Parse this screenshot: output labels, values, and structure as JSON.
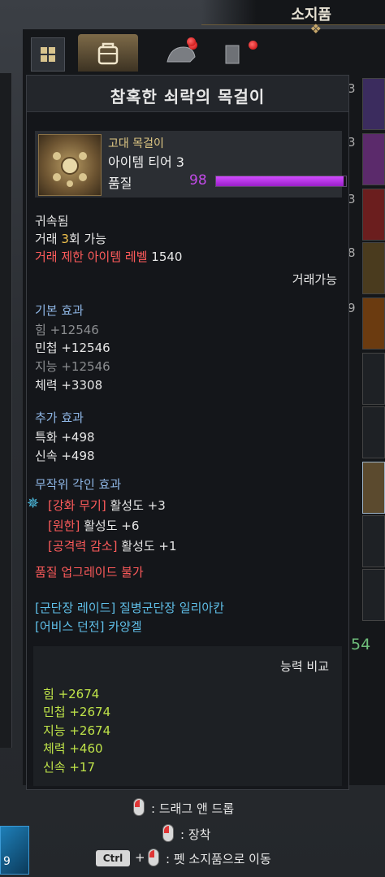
{
  "inventory": {
    "title": "소지품",
    "tabs": [
      "grid-tab",
      "bag-tab",
      "helmet-tab",
      "book-tab"
    ],
    "side_slot_numbers": [
      "3",
      "3",
      "3",
      "8",
      "9"
    ],
    "money": "54"
  },
  "tooltip": {
    "title": "참혹한 쇠락의 목걸이",
    "item": {
      "grade": "고대 목걸이",
      "tier": "아이템 티어 3",
      "quality_label": "품질",
      "quality_value": "98",
      "quality_fraction": 0.98
    },
    "bound": "귀속됨",
    "trade_prefix": "거래 ",
    "trade_count": "3",
    "trade_suffix": "회 가능",
    "trade_limit_label": "거래 제한 아이템 레벨",
    "trade_limit_value": "1540",
    "tradeable": "거래가능",
    "base_effects": {
      "heading": "기본 효과",
      "lines": [
        {
          "text": "힘 +12546",
          "dim": true
        },
        {
          "text": "민첩 +12546",
          "dim": false
        },
        {
          "text": "지능 +12546",
          "dim": true
        },
        {
          "text": "체력 +3308",
          "dim": false
        }
      ]
    },
    "extra_effects": {
      "heading": "추가 효과",
      "lines": [
        "특화 +498",
        "신속 +498"
      ]
    },
    "engravings": {
      "heading": "무작위 각인 효과",
      "lines": [
        {
          "name": "[강화 무기]",
          "value": "활성도 +3"
        },
        {
          "name": "[원한]",
          "value": "활성도 +6"
        },
        {
          "name": "[공격력 감소]",
          "value": "활성도 +1"
        }
      ]
    },
    "no_upgrade": "품질 업그레이드 불가",
    "sources": [
      "[군단장 레이드] 질병군단장 일리아칸",
      "[어비스 던전] 카양겔"
    ],
    "compare": {
      "heading": "능력 비교",
      "lines": [
        "힘 +2674",
        "민첩 +2674",
        "지능 +2674",
        "체력 +460",
        "신속 +17"
      ]
    }
  },
  "controls": {
    "drag": ": 드래그 앤 드롭",
    "equip": ": 장착",
    "ctrl_key": "Ctrl",
    "plus": "+",
    "pet_move": ": 펫 소지품으로 이동"
  },
  "skill_bar": {
    "slot_number": "9"
  },
  "colors": {
    "quality": "#c24ae8",
    "warning": "#ff5b5b",
    "section": "#8fb7e6",
    "source": "#5fbfe8",
    "compare": "#bfe349"
  }
}
